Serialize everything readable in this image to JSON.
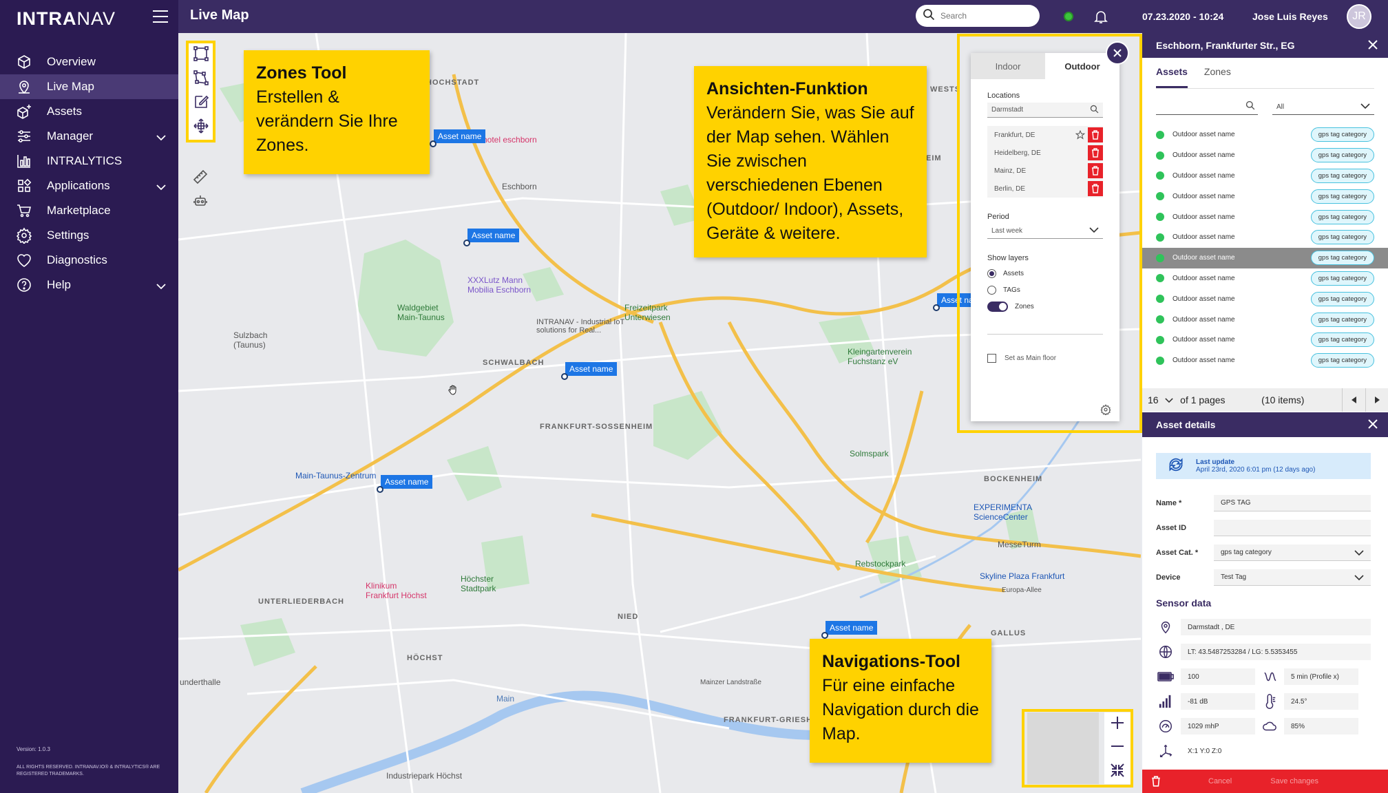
{
  "sidebar": {
    "logo_bold": "INTRA",
    "logo_light": "NAV",
    "items": [
      {
        "label": "Overview",
        "icon": "overview-icon"
      },
      {
        "label": "Live Map",
        "icon": "map-pin-icon",
        "active": true
      },
      {
        "label": "Assets",
        "icon": "assets-icon"
      },
      {
        "label": "Manager",
        "icon": "sliders-icon",
        "expandable": true
      },
      {
        "label": "INTRALYTICS",
        "icon": "bar-chart-icon"
      },
      {
        "label": "Applications",
        "icon": "apps-icon",
        "expandable": true
      },
      {
        "label": "Marketplace",
        "icon": "cart-icon"
      },
      {
        "label": "Settings",
        "icon": "gear-icon"
      },
      {
        "label": "Diagnostics",
        "icon": "heart-icon"
      },
      {
        "label": "Help",
        "icon": "help-icon",
        "expandable": true
      }
    ],
    "version": "Version: 1.0.3",
    "rights": "ALL RIGHTS RESERVED. INTRANAV.IO® & INTRALYTICS® ARE REGISTERED TRADEMARKS."
  },
  "topbar": {
    "title": "Live Map",
    "search_placeholder": "Search",
    "datetime": "07.23.2020 - 10:24",
    "user": "Jose Luis Reyes",
    "initials": "JR",
    "status_color": "#3cc43c"
  },
  "map": {
    "places": {
      "hochstadt": "HOCHSTADT",
      "hotel": "hotel eschborn",
      "eschborn": "Eschborn",
      "xxxlutz": "XXXLutz Mann Mobilia Eschborn",
      "intranav": "INTRANAV - Industrial IoT solutions for Real...",
      "freizeitpark": "Freizeitpark Unterwiesen",
      "schwalbach": "SCHWALBACH",
      "sulzbach": "Sulzbach (Taunus)",
      "waldgebiet": "Waldgebiet Main-Taunus",
      "sossenheim": "FRANKFURT-SOSSENHEIM",
      "mtz": "Main-Taunus-Zentrum",
      "kleingarten": "Kleingartenverein Fuchstanz eV",
      "solmspark": "Solmspark",
      "bockenheim": "BOCKENHEIM",
      "experimenta": "EXPERIMENTA ScienceCenter",
      "messeturm": "MesseTurm",
      "rebstock": "Rebstockpark",
      "skyline": "Skyline Plaza Frankfurt",
      "europa": "Europa-Allee",
      "gallus": "GALLUS",
      "klinikum": "Klinikum Frankfurt Höchst",
      "unterliederbach": "UNTERLIEDERBACH",
      "hoechster": "Höchster Stadtpark",
      "nied": "NIED",
      "hoechst": "HÖCHST",
      "griesheim": "FRANKFURT-GRIESH",
      "industriepark": "Industriepark Höchst",
      "underhalle": "underthalle",
      "main": "Main",
      "westend": "WESTS",
      "heim": "EIM",
      "mainzer": "Mainzer Landstraße"
    },
    "asset_pins": [
      "Asset name",
      "Asset name",
      "Asset name",
      "Asset name",
      "Asset name",
      "Asset name",
      "Asset na"
    ]
  },
  "callouts": {
    "zones": {
      "title": "Zones Tool",
      "text": "Erstellen & verändern Sie Ihre Zones."
    },
    "views": {
      "title": "Ansichten-Funktion",
      "text": "Verändern Sie, was Sie auf der Map sehen. Wählen Sie zwischen verschiedenen Ebenen (Outdoor/ Indoor), Assets, Geräte & weitere."
    },
    "nav": {
      "title": "Navigations-Tool",
      "text": "Für eine einfache Navigation durch die Map."
    }
  },
  "view_panel": {
    "tabs": [
      "Indoor",
      "Outdoor"
    ],
    "active_tab": "Outdoor",
    "locations_label": "Locations",
    "location_search": "Darmstadt",
    "locations": [
      "Frankfurt, DE",
      "Heidelberg, DE",
      "Mainz, DE",
      "Berlin, DE"
    ],
    "period_label": "Period",
    "period_value": "Last week",
    "layers_label": "Show layers",
    "layers": [
      "Assets",
      "TAGs",
      "Zones"
    ],
    "main_floor": "Set as Main floor"
  },
  "right_panel": {
    "title": "Eschborn, Frankfurter Str., EG",
    "tabs": [
      "Assets",
      "Zones"
    ],
    "filter_value": "All",
    "assets": [
      {
        "name": "Outdoor asset name",
        "tag": "gps tag category"
      },
      {
        "name": "Outdoor asset name",
        "tag": "gps tag category"
      },
      {
        "name": "Outdoor asset name",
        "tag": "gps tag category"
      },
      {
        "name": "Outdoor asset name",
        "tag": "gps tag category"
      },
      {
        "name": "Outdoor asset name",
        "tag": "gps tag category"
      },
      {
        "name": "Outdoor asset name",
        "tag": "gps tag category"
      },
      {
        "name": "Outdoor asset name",
        "tag": "gps tag category",
        "selected": true
      },
      {
        "name": "Outdoor asset name",
        "tag": "gps tag category"
      },
      {
        "name": "Outdoor asset name",
        "tag": "gps tag category"
      },
      {
        "name": "Outdoor asset name",
        "tag": "gps tag category"
      },
      {
        "name": "Outdoor asset name",
        "tag": "gps tag category"
      },
      {
        "name": "Outdoor asset name",
        "tag": "gps tag category"
      }
    ],
    "pager": {
      "per_page": "16",
      "pages": "of 1 pages",
      "items": "(10 items)"
    }
  },
  "asset_details": {
    "title": "Asset details",
    "last_update_label": "Last update",
    "last_update_value": "April 23rd, 2020 6:01 pm (12 days ago)",
    "fields": [
      {
        "label": "Name *",
        "value": ""
      },
      {
        "label": "Asset ID",
        "value": ""
      },
      {
        "label": "Asset Cat. *",
        "value": "gps tag category",
        "dropdown": true
      },
      {
        "label": "Device",
        "value": "Test Tag",
        "dropdown": true
      }
    ],
    "name_value": "GPS TAG",
    "sensor_title": "Sensor data",
    "location": "Darmstadt , DE",
    "coords": "LT: 43.5487253284 / LG: 5.5353455",
    "battery": "100",
    "interval": "5 min (Profile x)",
    "signal": "-81 dB",
    "temperature": "24.5°",
    "pressure": "1029 mhP",
    "humidity": "85%",
    "xyz": "X:1   Y:0   Z:0",
    "cancel": "Cancel",
    "save": "Save changes"
  }
}
